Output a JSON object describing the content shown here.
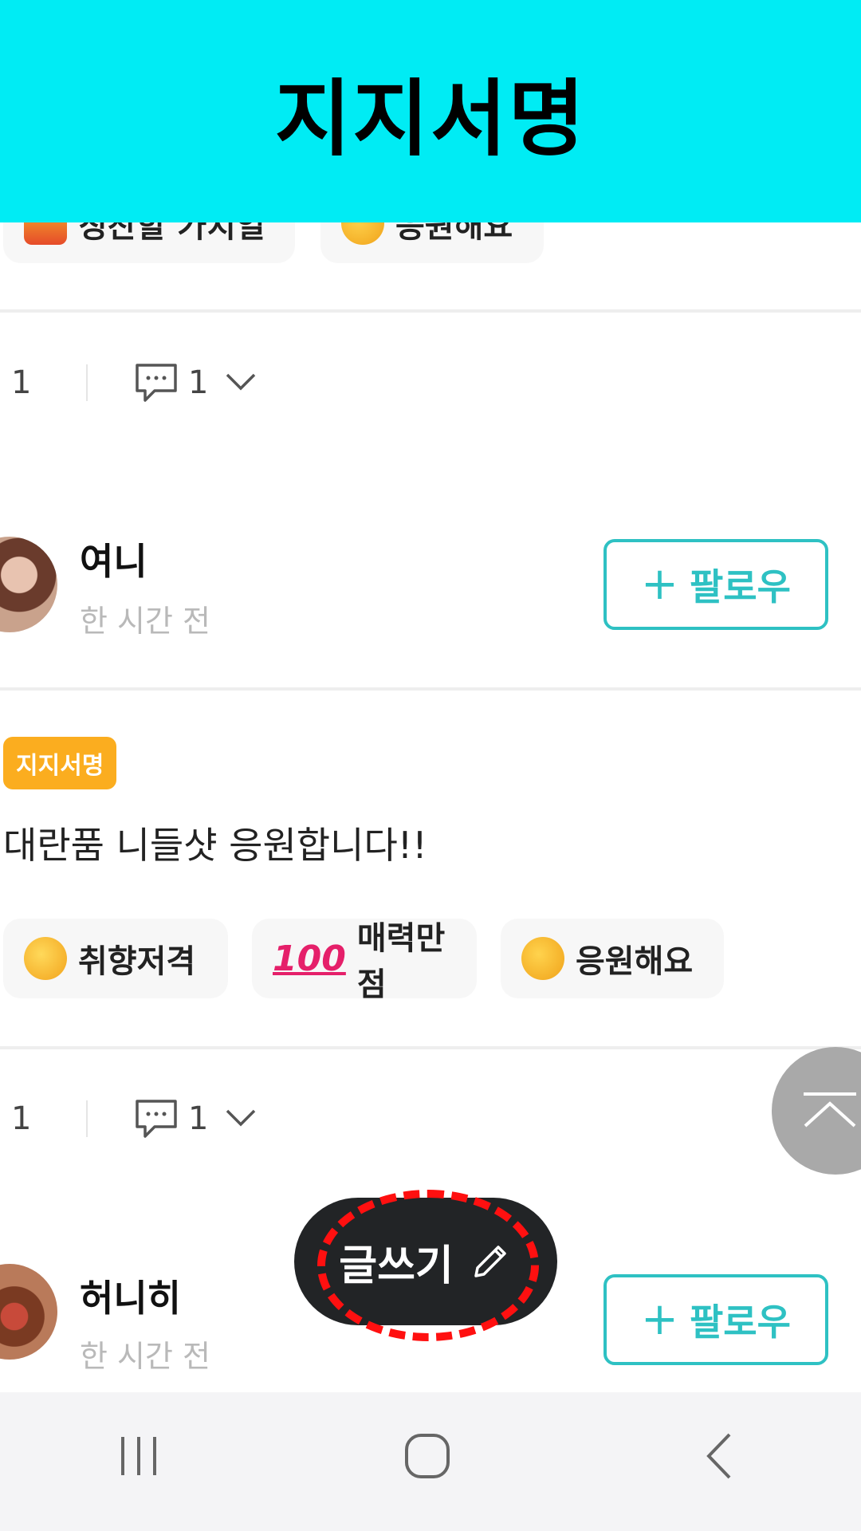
{
  "banner": {
    "title": "지지서명",
    "color": "#00ecf4"
  },
  "top_reactions": [
    {
      "emoji": "gift-emoji",
      "label": "칭찬할 가치일"
    },
    {
      "emoji": "clap-emoji",
      "label": "응원해요"
    }
  ],
  "stats": [
    {
      "likes": "1",
      "comments": "1"
    },
    {
      "likes": "1",
      "comments": "1"
    }
  ],
  "posts": [
    {
      "username": "여니",
      "time": "한 시간 전",
      "follow_label": "팔로우"
    },
    {
      "username": "허니히",
      "time": "한 시간 전",
      "follow_label": "팔로우"
    }
  ],
  "post1_content": {
    "tag": "지지서명",
    "text": "대란품 니들샷 응원합니다!!",
    "reactions": [
      {
        "emoji": "hugging-face-emoji",
        "label": "취향저격"
      },
      {
        "emoji": "hundred-points-emoji",
        "symbol": "100",
        "label": "매력만점"
      },
      {
        "emoji": "clapping-hands-emoji",
        "label": "응원해요"
      }
    ]
  },
  "fab": {
    "label": "글쓰기",
    "icon": "pencil-icon"
  },
  "colors": {
    "accent": "#2ec1c3",
    "tag": "#fbad1f",
    "fab": "#222426",
    "highlight": "#ff1010"
  },
  "navbar": {
    "buttons": [
      "recent-apps-icon",
      "home-icon",
      "back-icon"
    ]
  }
}
